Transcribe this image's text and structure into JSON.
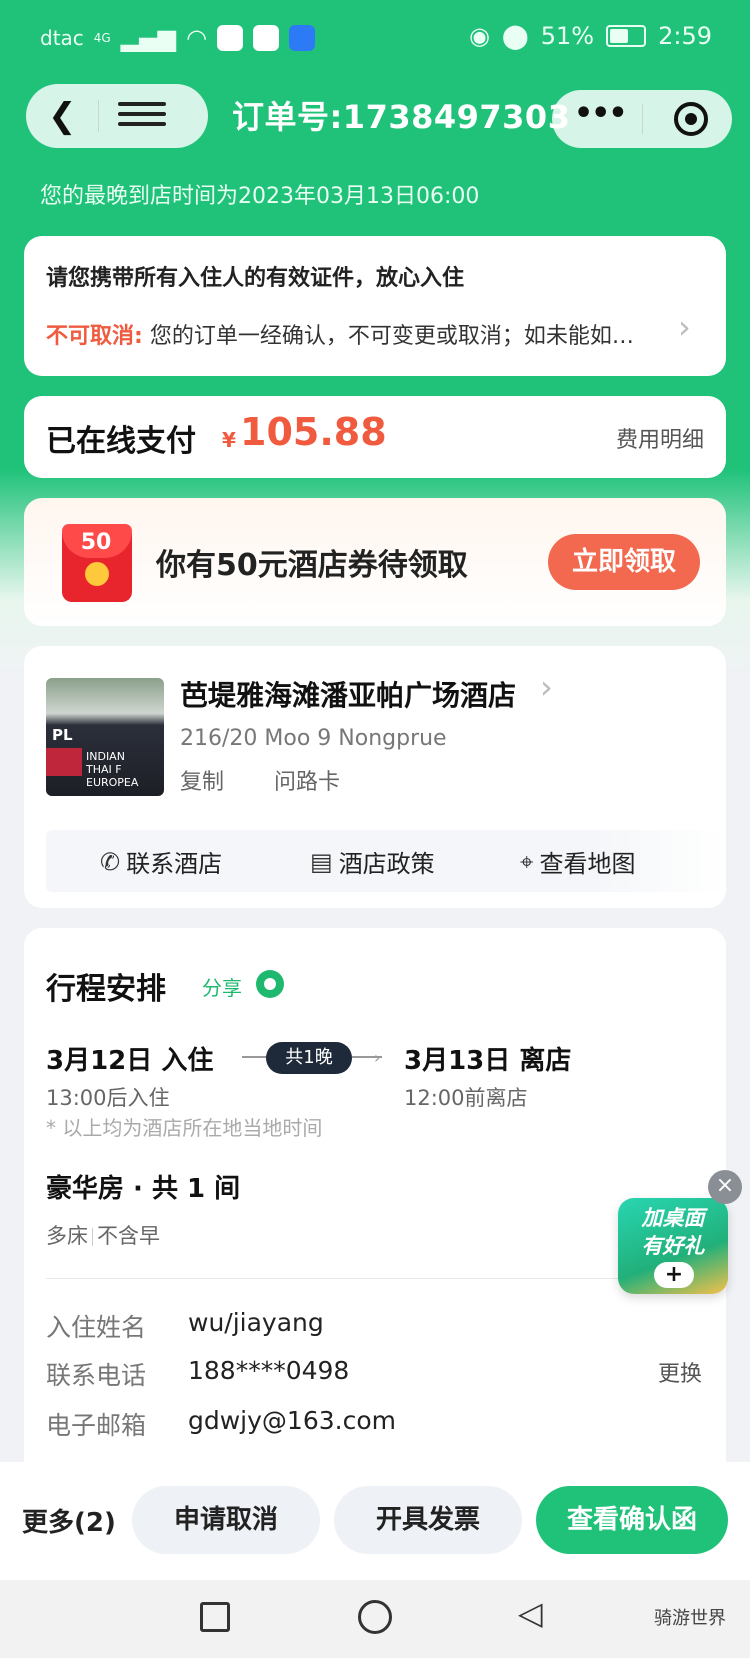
{
  "status_bar": {
    "carrier": "dtac",
    "network": "4G",
    "battery": "51%",
    "time": "2:59"
  },
  "nav": {
    "back_icon": "back-arrow-icon",
    "menu_icon": "menu-icon",
    "title": "订单号:1738497303",
    "more_icon": "more-icon",
    "close_icon": "target-icon"
  },
  "latest_arrival": "您的最晚到店时间为2023年03月13日06:00",
  "notice": {
    "main": "请您携带所有入住人的有效证件，放心入住",
    "policy_label": "不可取消:",
    "policy_text": "您的订单一经确认，不可变更或取消；如未能如…"
  },
  "payment": {
    "label": "已在线支付",
    "currency": "¥",
    "amount": "105.88",
    "detail_link": "费用明细"
  },
  "coupon": {
    "badge": "50",
    "text": "你有50元酒店券待领取",
    "button": "立即领取"
  },
  "hotel": {
    "name": "芭堤雅海滩潘亚帕广场酒店",
    "address": "216/20 Moo 9 Nongprue",
    "copy": "复制",
    "direction_card": "问路卡",
    "image_sign": "PL",
    "image_text": "INDIAN",
    "image_text2": "THAI F",
    "image_text3": "EUROPEA",
    "actions": [
      {
        "icon": "phone-icon",
        "label": "联系酒店"
      },
      {
        "icon": "document-icon",
        "label": "酒店政策"
      },
      {
        "icon": "map-pin-icon",
        "label": "查看地图"
      }
    ]
  },
  "itinerary": {
    "title": "行程安排",
    "share": "分享",
    "checkin_date": "3月12日  入住",
    "checkin_time": "13:00后入住",
    "nights": "共1晚",
    "checkout_date": "3月13日  离店",
    "checkout_time": "12:00前离店",
    "tz_note": "* 以上均为酒店所在地当地时间",
    "room_title": "豪华房 · 共 1 间",
    "room_tags": [
      "多床",
      "不含早"
    ],
    "info": [
      {
        "label": "入住姓名",
        "value": "wu/jiayang"
      },
      {
        "label": "联系电话",
        "value": "188****0498",
        "action": "更换"
      },
      {
        "label": "电子邮箱",
        "value": "gdwjy@163.com"
      }
    ]
  },
  "floating": {
    "text_line1": "加桌面",
    "text_line2": "有好礼",
    "plus": "+",
    "close": "×"
  },
  "action_bar": {
    "more": "更多(2)",
    "cancel": "申请取消",
    "invoice": "开具发票",
    "confirm": "查看确认函"
  },
  "watermark": "骑游世界",
  "colors": {
    "primary_green": "#20c27a",
    "price_red": "#f05a3f",
    "coupon_button": "#f3694f"
  }
}
